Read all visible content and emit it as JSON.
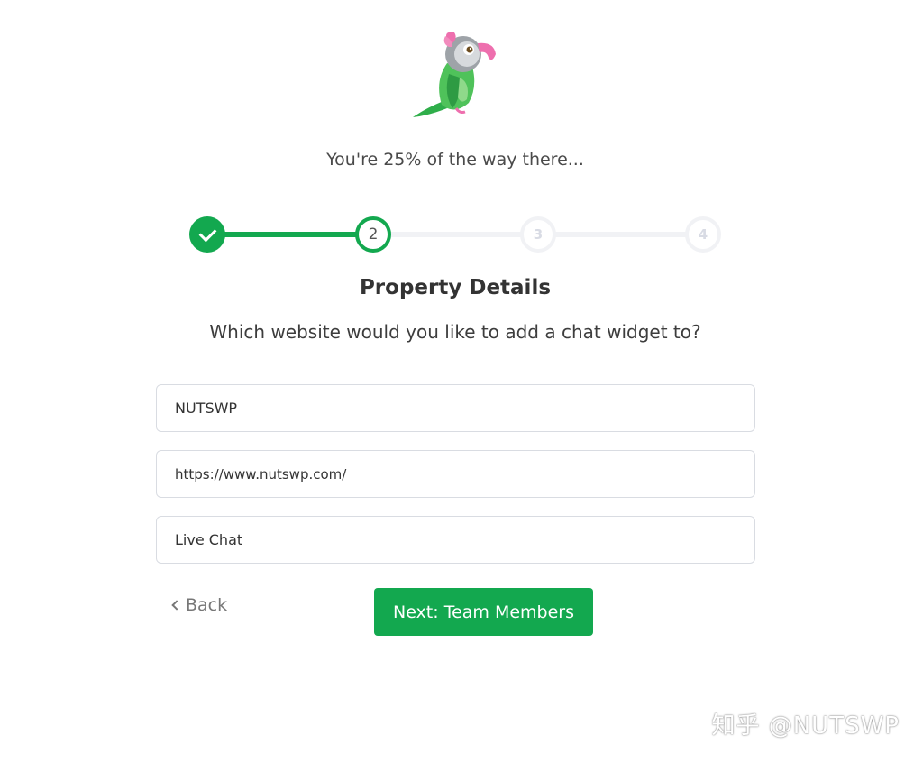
{
  "logo": {
    "icon": "parrot-logo-icon"
  },
  "progress": {
    "text": "You're 25% of the way there...",
    "fraction": 0.25
  },
  "stepper": {
    "current": 2,
    "steps": [
      {
        "label": "1",
        "state": "done",
        "icon": "check-icon"
      },
      {
        "label": "2",
        "state": "current"
      },
      {
        "label": "3",
        "state": "upcoming"
      },
      {
        "label": "4",
        "state": "upcoming"
      }
    ]
  },
  "header": {
    "title": "Property Details",
    "subtitle": "Which website would you like to add a chat widget to?"
  },
  "form": {
    "property_name": "NUTSWP",
    "website_url": "https://www.nutswp.com/",
    "widget_name": "Live Chat"
  },
  "actions": {
    "back_label": "Back",
    "next_label": "Next: Team Members"
  },
  "watermark": {
    "text": "知乎 @NUTSWP"
  },
  "colors": {
    "accent": "#13a84f",
    "track_inactive": "#f1f2f5",
    "border": "#d9dce2"
  }
}
